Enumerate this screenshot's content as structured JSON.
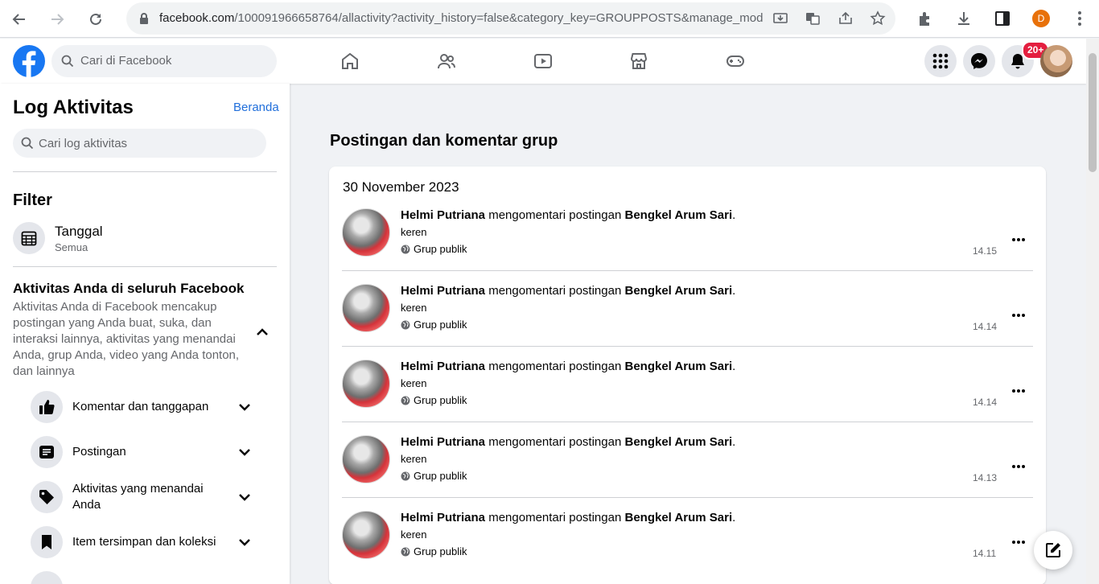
{
  "browser": {
    "url_host": "facebook.com",
    "url_path": "/100091966658764/allactivity?activity_history=false&category_key=GROUPPOSTS&manage_mod...",
    "profile_initial": "D"
  },
  "header": {
    "search_placeholder": "Cari di Facebook",
    "notification_badge": "20+"
  },
  "sidebar": {
    "title": "Log Aktivitas",
    "home_link": "Beranda",
    "search_placeholder": "Cari log aktivitas",
    "filter_heading": "Filter",
    "date_filter": {
      "label": "Tanggal",
      "value": "Semua"
    },
    "section_title": "Aktivitas Anda di seluruh Facebook",
    "section_desc": "Aktivitas Anda di Facebook mencakup postingan yang Anda buat, suka, dan interaksi lainnya, aktivitas yang menandai Anda, grup Anda, video yang Anda tonton, dan lainnya",
    "categories": [
      {
        "label": "Komentar dan tanggapan",
        "icon": "thumbs-up-icon"
      },
      {
        "label": "Postingan",
        "icon": "post-icon"
      },
      {
        "label": "Aktivitas yang menandai Anda",
        "icon": "tag-icon"
      },
      {
        "label": "Item tersimpan dan koleksi",
        "icon": "bookmark-icon"
      }
    ]
  },
  "main": {
    "title": "Postingan dan komentar grup",
    "date": "30 November 2023",
    "entries": [
      {
        "actor": "Helmi Putriana",
        "verb": "mengomentari postingan",
        "target": "Bengkel Arum Sari",
        "comment": "keren",
        "audience": "Grup publik",
        "time": "14.15"
      },
      {
        "actor": "Helmi Putriana",
        "verb": "mengomentari postingan",
        "target": "Bengkel Arum Sari",
        "comment": "keren",
        "audience": "Grup publik",
        "time": "14.14"
      },
      {
        "actor": "Helmi Putriana",
        "verb": "mengomentari postingan",
        "target": "Bengkel Arum Sari",
        "comment": "keren",
        "audience": "Grup publik",
        "time": "14.14"
      },
      {
        "actor": "Helmi Putriana",
        "verb": "mengomentari postingan",
        "target": "Bengkel Arum Sari",
        "comment": "keren",
        "audience": "Grup publik",
        "time": "14.13"
      },
      {
        "actor": "Helmi Putriana",
        "verb": "mengomentari postingan",
        "target": "Bengkel Arum Sari",
        "comment": "keren",
        "audience": "Grup publik",
        "time": "14.11"
      }
    ]
  },
  "colors": {
    "brand": "#1877f2",
    "link": "#216fdb",
    "badge": "#e41e3f",
    "background": "#f0f2f5"
  }
}
